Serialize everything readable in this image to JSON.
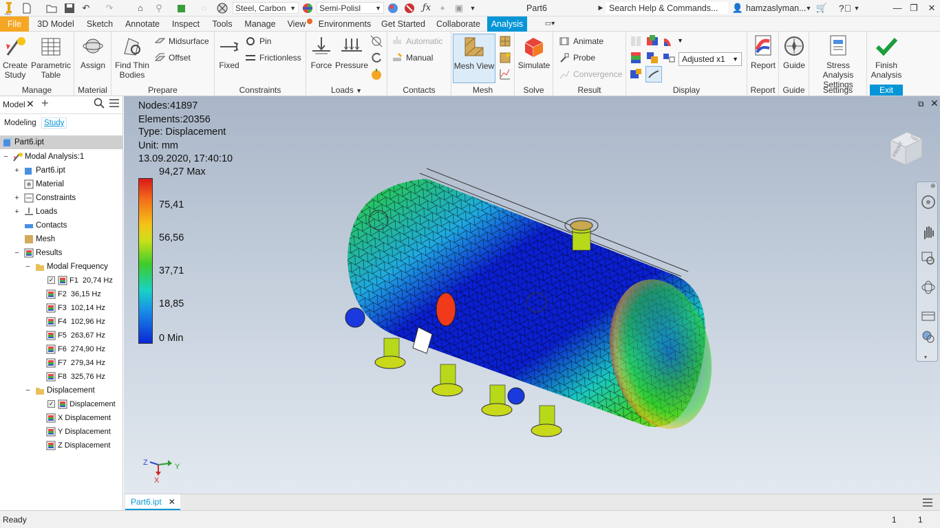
{
  "quick_access": {
    "material": "Steel, Carbon",
    "appearance": "Semi-Polisl",
    "doc_title": "Part6",
    "search_placeholder": "Search Help & Commands...",
    "user": "hamzaslyman..."
  },
  "menu_tabs": [
    "File",
    "3D Model",
    "Sketch",
    "Annotate",
    "Inspect",
    "Tools",
    "Manage",
    "View",
    "Environments",
    "Get Started",
    "Collaborate",
    "Analysis"
  ],
  "ribbon": {
    "manage": {
      "label": "Manage",
      "create_study": [
        "Create",
        "Study"
      ],
      "parametric_table": [
        "Parametric",
        "Table"
      ]
    },
    "material": {
      "label": "Material",
      "assign": "Assign"
    },
    "prepare": {
      "label": "Prepare",
      "find_thin": [
        "Find Thin",
        "Bodies"
      ],
      "midsurface": "Midsurface",
      "offset": "Offset"
    },
    "constraints": {
      "label": "Constraints",
      "fixed": "Fixed",
      "pin": "Pin",
      "frictionless": "Frictionless"
    },
    "loads": {
      "label": "Loads",
      "force": "Force",
      "pressure": "Pressure"
    },
    "contacts": {
      "label": "Contacts",
      "automatic": "Automatic",
      "manual": "Manual"
    },
    "mesh": {
      "label": "Mesh",
      "mesh_view": "Mesh View"
    },
    "solve": {
      "label": "Solve",
      "simulate": "Simulate"
    },
    "result": {
      "label": "Result",
      "animate": "Animate",
      "probe": "Probe",
      "convergence": "Convergence"
    },
    "display": {
      "label": "Display",
      "scale": "Adjusted x1"
    },
    "report": {
      "label": "Report",
      "report": "Report"
    },
    "guide": {
      "label": "Guide",
      "guide": "Guide"
    },
    "settings": {
      "label": "Settings",
      "stress": [
        "Stress Analysis",
        "Settings"
      ]
    },
    "exit": {
      "label": "Exit",
      "finish": [
        "Finish",
        "Analysis"
      ]
    }
  },
  "browser": {
    "title": "Model",
    "tab_modeling": "Modeling",
    "tab_study": "Study",
    "root": "Part6.ipt",
    "analysis": "Modal Analysis:1",
    "nodes": [
      "Part6.ipt",
      "Material",
      "Constraints",
      "Loads",
      "Contacts",
      "Mesh",
      "Results"
    ],
    "modal_frequency": "Modal Frequency",
    "frequencies": [
      {
        "name": "F1",
        "value": "20,74 Hz"
      },
      {
        "name": "F2",
        "value": "36,15 Hz"
      },
      {
        "name": "F3",
        "value": "102,14 Hz"
      },
      {
        "name": "F4",
        "value": "102,96 Hz"
      },
      {
        "name": "F5",
        "value": "263,67 Hz"
      },
      {
        "name": "F6",
        "value": "274,90 Hz"
      },
      {
        "name": "F7",
        "value": "279,34 Hz"
      },
      {
        "name": "F8",
        "value": "325,76 Hz"
      }
    ],
    "displacement_folder": "Displacement",
    "displacements": [
      "Displacement",
      "X Displacement",
      "Y Displacement",
      "Z Displacement"
    ]
  },
  "viewport": {
    "nodes": "Nodes:41897",
    "elements": "Elements:20356",
    "type": "Type: Displacement",
    "unit": "Unit: mm",
    "datetime": "13.09.2020, 17:40:10",
    "legend": [
      "94,27 Max",
      "75,41",
      "56,56",
      "37,71",
      "18,85",
      "0 Min"
    ],
    "viewcube_face": "FRONT",
    "viewcube_top": "TOP",
    "axis_labels": {
      "x": "X",
      "y": "Y",
      "z": "Z"
    }
  },
  "doc_tab": "Part6.ipt",
  "status": {
    "text": "Ready",
    "count1": "1",
    "count2": "1"
  },
  "colors": {
    "accent": "#0696d7",
    "file_tab": "#f5a623",
    "exit_bar": "#0696d7"
  }
}
